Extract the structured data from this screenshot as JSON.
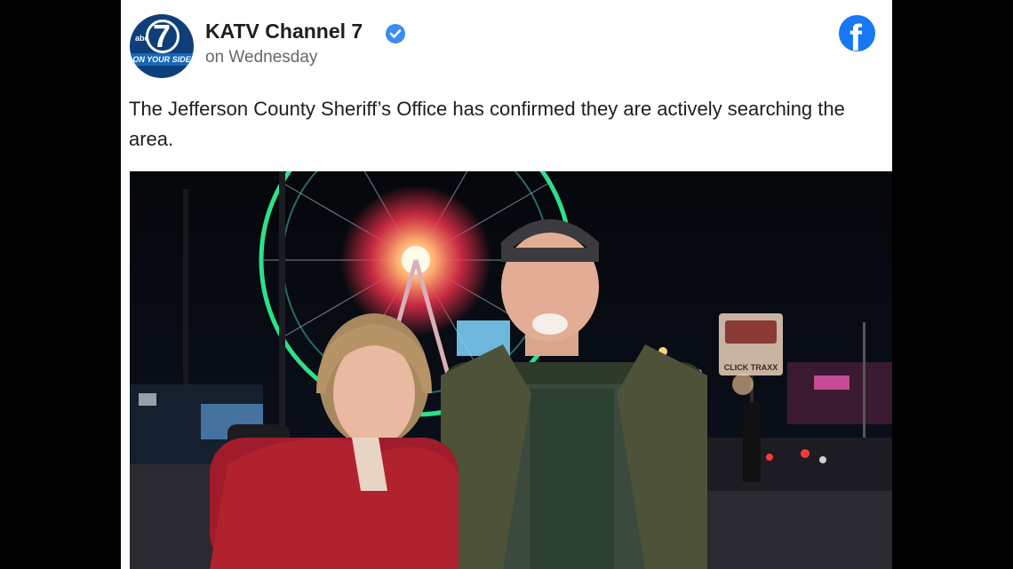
{
  "post": {
    "page_name": "KATV Channel 7",
    "timestamp": "on Wednesday",
    "text": "The Jefferson County Sheriff’s Office has confirmed they are actively searching the area.",
    "avatar": {
      "station_number": "7",
      "network": "abc",
      "tagline": "ON YOUR SIDE"
    },
    "icons": {
      "verified": "verified-badge-icon",
      "platform": "facebook-icon"
    },
    "photo": {
      "sign_text": "CLICK TRAXX"
    }
  },
  "colors": {
    "page_background": "#000000",
    "card_background": "#ffffff",
    "verified_blue": "#3b8df5",
    "facebook_blue": "#1877f2",
    "avatar_blue": "#0e3f7a"
  }
}
